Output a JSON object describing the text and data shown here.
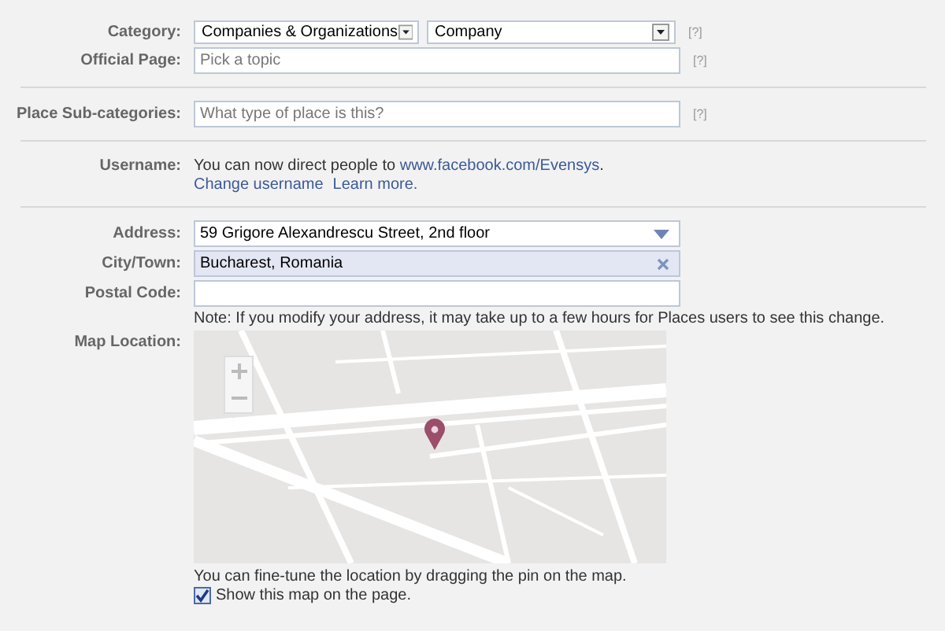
{
  "sections": [
    {
      "rows": [
        {
          "kind": "selects",
          "label": "Category:",
          "selects": [
            {
              "value": "Companies & Organizations"
            },
            {
              "value": "Company"
            }
          ],
          "help": "[?]"
        },
        {
          "kind": "input",
          "label": "Official Page:",
          "placeholder": "Pick a topic",
          "help": "[?]"
        }
      ]
    },
    {
      "rows": [
        {
          "kind": "input",
          "label": "Place Sub-categories:",
          "placeholder": "What type of place is this?",
          "help": "[?]"
        }
      ]
    },
    {
      "rows": [
        {
          "kind": "info",
          "label": "Username:",
          "text": "You can now direct people to ",
          "link": "www.facebook.com/Evensys",
          "after": ".",
          "links": [
            "Change username",
            "Learn more."
          ]
        }
      ]
    },
    {
      "rows": [
        {
          "kind": "input",
          "label": "Address:",
          "value": "59 Grigore Alexandrescu Street, 2nd floor",
          "dropdown": true
        },
        {
          "kind": "input",
          "label": "City/Town:",
          "value": "Bucharest, Romania",
          "highlighted": true,
          "clearable": true
        },
        {
          "kind": "input",
          "label": "Postal Code:"
        },
        {
          "kind": "note",
          "text": "Note: If you modify your address, it may take up to a few hours for Places users to see this change."
        },
        {
          "kind": "map",
          "label": "Map Location:",
          "caption": "You can fine-tune the location by dragging the pin on the map.",
          "checkbox": {
            "label": "Show this map on the page.",
            "checked": true
          }
        }
      ]
    }
  ]
}
